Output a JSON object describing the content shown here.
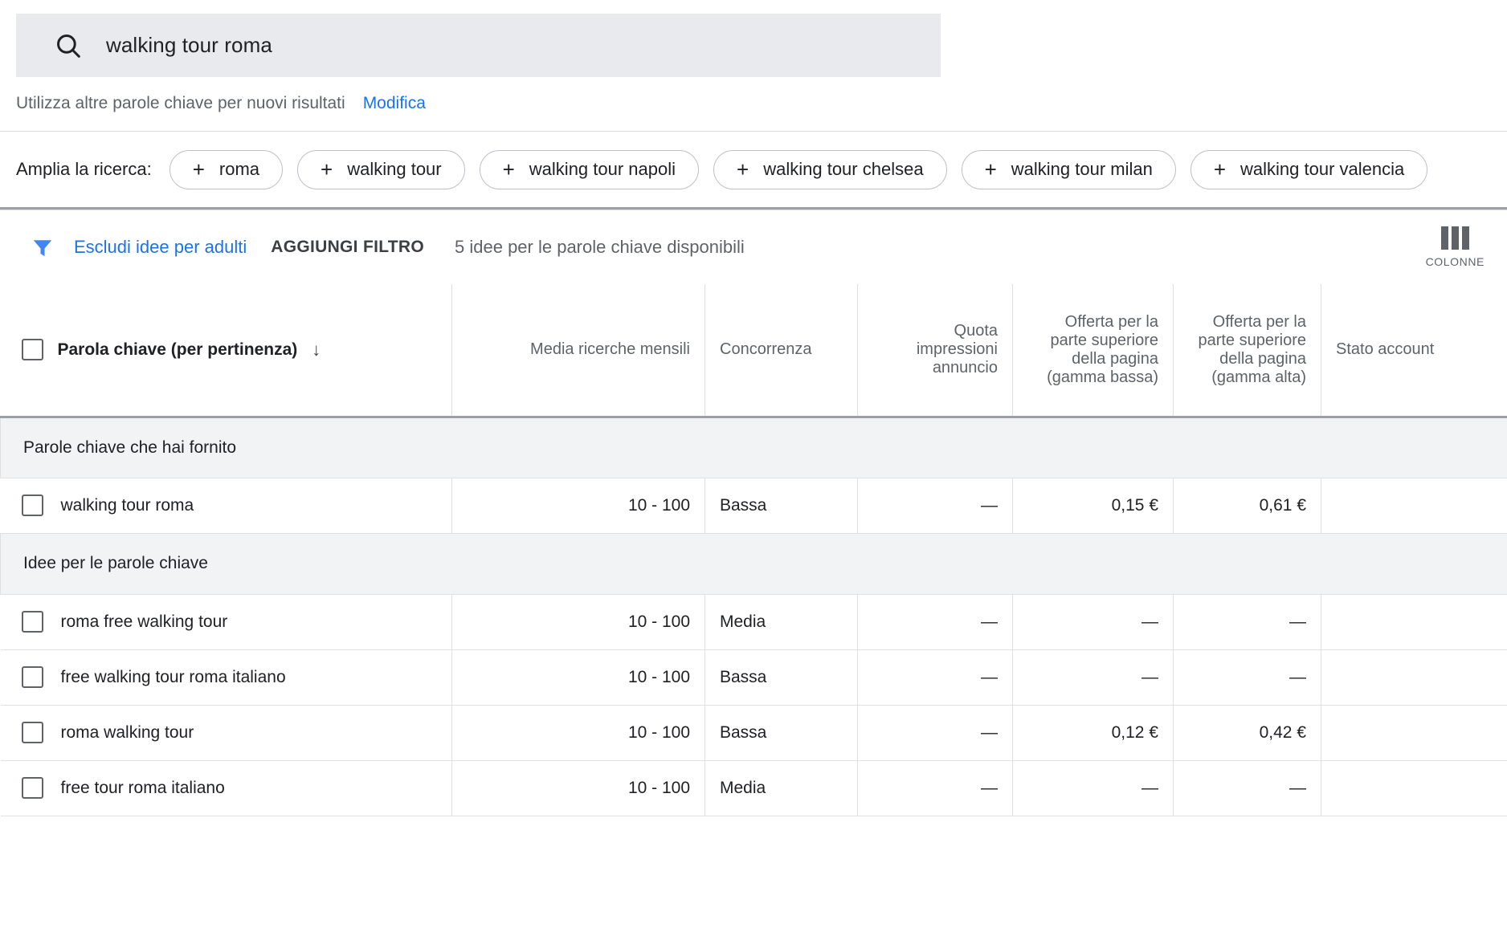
{
  "search": {
    "icon": "search-icon",
    "value": "walking tour roma",
    "hint_text": "Utilizza altre parole chiave per nuovi risultati",
    "hint_link": "Modifica"
  },
  "expand": {
    "label": "Amplia la ricerca:",
    "plus": "+",
    "chips": [
      "roma",
      "walking tour",
      "walking tour napoli",
      "walking tour chelsea",
      "walking tour milan",
      "walking tour valencia"
    ]
  },
  "filter_bar": {
    "funnel_icon": "filter-funnel-icon",
    "exclude_adult_label": "Escludi idee per adulti",
    "add_filter_label": "AGGIUNGI FILTRO",
    "ideas_count_label": "5 idee per le parole chiave disponibili",
    "columns_icon": "columns-icon",
    "columns_label": "COLONNE"
  },
  "table": {
    "headers": {
      "keyword": "Parola chiave (per pertinenza)",
      "sort_arrow": "↓",
      "avg_monthly_searches": "Media ricerche mensili",
      "competition": "Concorrenza",
      "ad_impression_share": "Quota impressioni annuncio",
      "top_of_page_bid_low": "Offerta per la parte superiore della pagina (gamma bassa)",
      "top_of_page_bid_high": "Offerta per la parte superiore della pagina (gamma alta)",
      "account_status": "Stato account"
    },
    "groups": [
      {
        "title": "Parole chiave che hai fornito",
        "rows": [
          {
            "keyword": "walking tour roma",
            "searches": "10 - 100",
            "competition": "Bassa",
            "impression_share": "—",
            "bid_low": "0,15 €",
            "bid_high": "0,61 €",
            "account_status": ""
          }
        ]
      },
      {
        "title": "Idee per le parole chiave",
        "rows": [
          {
            "keyword": "roma free walking tour",
            "searches": "10 - 100",
            "competition": "Media",
            "impression_share": "—",
            "bid_low": "—",
            "bid_high": "—",
            "account_status": ""
          },
          {
            "keyword": "free walking tour roma italiano",
            "searches": "10 - 100",
            "competition": "Bassa",
            "impression_share": "—",
            "bid_low": "—",
            "bid_high": "—",
            "account_status": ""
          },
          {
            "keyword": "roma walking tour",
            "searches": "10 - 100",
            "competition": "Bassa",
            "impression_share": "—",
            "bid_low": "0,12 €",
            "bid_high": "0,42 €",
            "account_status": ""
          },
          {
            "keyword": "free tour roma italiano",
            "searches": "10 - 100",
            "competition": "Media",
            "impression_share": "—",
            "bid_low": "—",
            "bid_high": "—",
            "account_status": ""
          }
        ]
      }
    ]
  },
  "colors": {
    "accent_blue": "#1a73e8",
    "search_bg": "#e8eaed",
    "group_bg": "#f1f3f4",
    "text_secondary": "#5f6368",
    "border": "#e0e0e0"
  }
}
